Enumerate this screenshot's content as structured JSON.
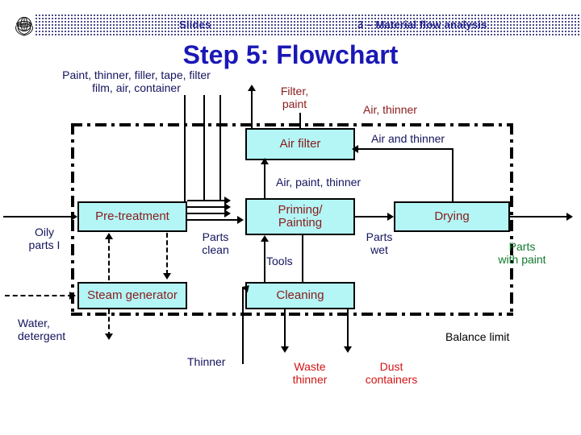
{
  "header": {
    "logo_alt": "UNIDO",
    "slides_label": "Slides",
    "topic_label": "3 – Material flow analysis"
  },
  "title": "Step 5: Flowchart",
  "diagram": {
    "boxes": [
      {
        "id": "air_filter",
        "label": "Air filter"
      },
      {
        "id": "pre_treatment",
        "label": "Pre-treatment"
      },
      {
        "id": "priming",
        "label": "Priming/\nPainting"
      },
      {
        "id": "drying",
        "label": "Drying"
      },
      {
        "id": "steam_generator",
        "label": "Steam generator"
      },
      {
        "id": "cleaning",
        "label": "Cleaning"
      }
    ],
    "labels": {
      "inputs_top": "Paint, thinner, filler, tape, filter\nfilm, air, container",
      "filter_paint": "Filter,\npaint",
      "air_thinner": "Air, thinner",
      "air_and_thinner": "Air and thinner",
      "air_paint_thinner": "Air, paint, thinner",
      "oily_parts": "Oily\nparts I",
      "parts_clean": "Parts\nclean",
      "tools": "Tools",
      "parts_wet": "Parts\nwet",
      "parts_with_paint": "Parts\nwith paint",
      "water_detergent": "Water,\ndetergent",
      "thinner": "Thinner",
      "waste_thinner": "Waste\nthinner",
      "dust_containers": "Dust\ncontainers",
      "balance_limit": "Balance limit"
    }
  },
  "colors": {
    "box_fill": "#b4f5f5",
    "box_text": "#8a1b1b",
    "title": "#1a18b5",
    "navy_text": "#13145e",
    "red_text": "#d11414",
    "green_text": "#117a2e",
    "header_text": "#1f1f8f"
  }
}
